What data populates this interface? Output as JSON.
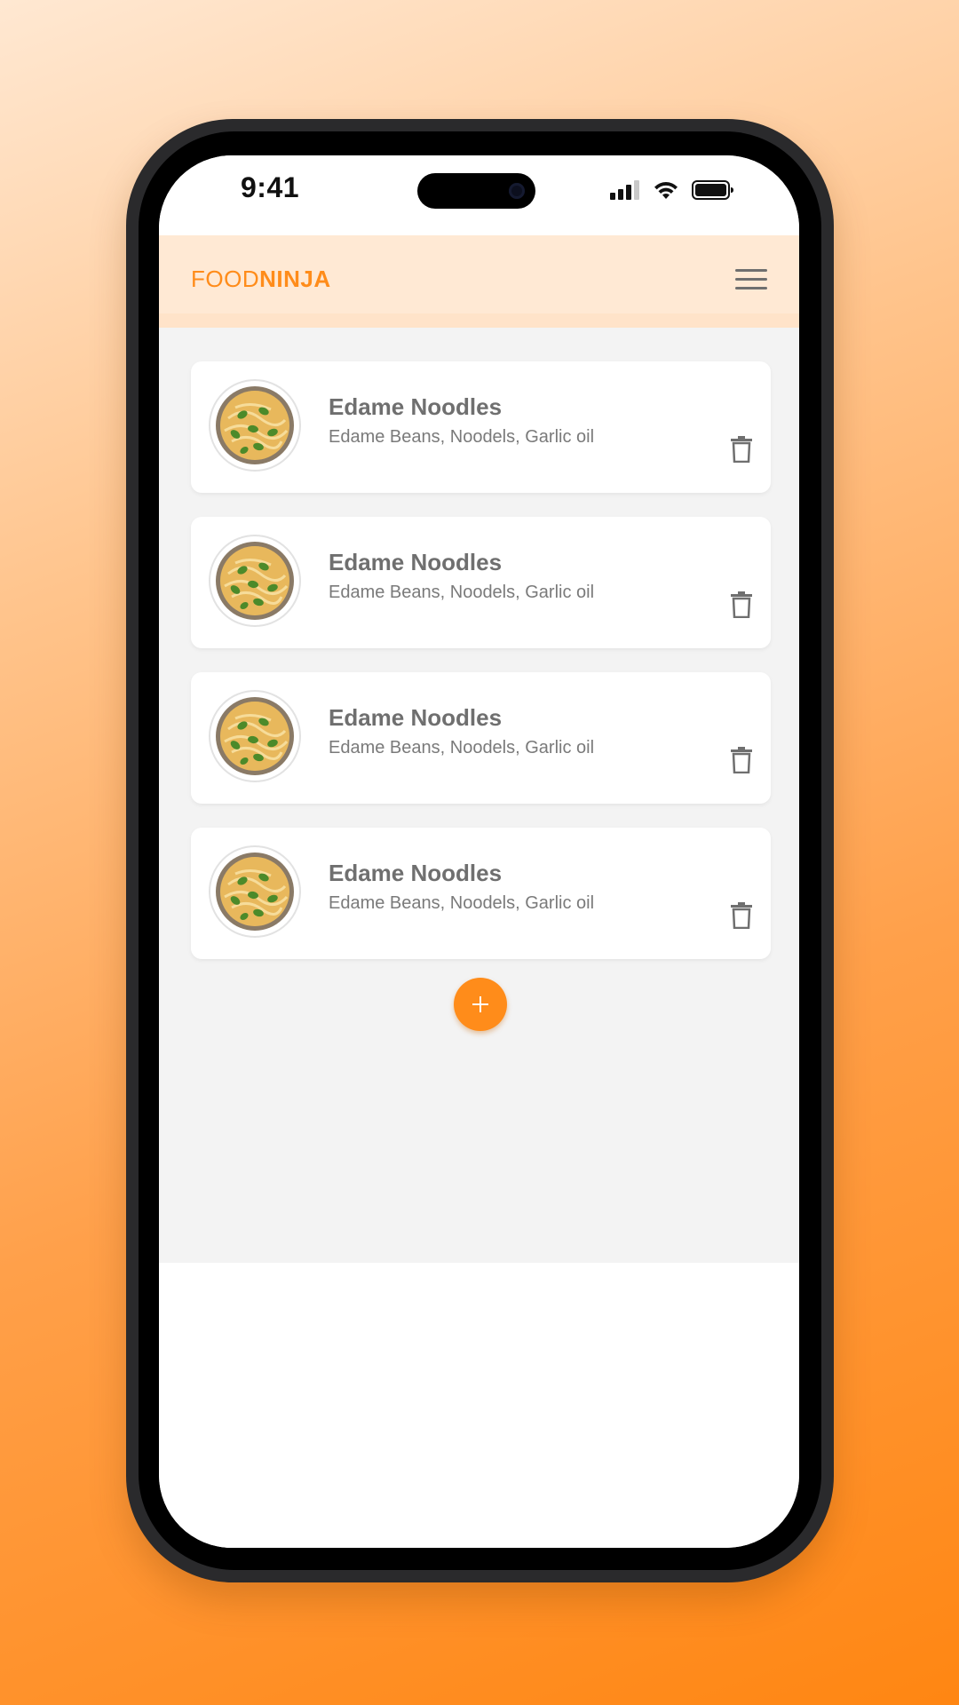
{
  "status_bar": {
    "time": "9:41"
  },
  "app_bar": {
    "brand_light": "FOOD",
    "brand_bold": "NINJA",
    "menu_icon": "hamburger-menu-icon"
  },
  "dishes": [
    {
      "title": "Edame Noodles",
      "description": "Edame Beans, Noodels, Garlic oil",
      "image_icon": "noodle-bowl-icon",
      "action_icon": "trash-icon"
    },
    {
      "title": "Edame Noodles",
      "description": "Edame Beans, Noodels, Garlic oil",
      "image_icon": "noodle-bowl-icon",
      "action_icon": "trash-icon"
    },
    {
      "title": "Edame Noodles",
      "description": "Edame Beans, Noodels, Garlic oil",
      "image_icon": "noodle-bowl-icon",
      "action_icon": "trash-icon"
    },
    {
      "title": "Edame Noodles",
      "description": "Edame Beans, Noodels, Garlic oil",
      "image_icon": "noodle-bowl-icon",
      "action_icon": "trash-icon"
    }
  ],
  "add_button": {
    "icon": "plus-icon"
  },
  "colors": {
    "accent": "#ff8c1a",
    "app_bar_bg": "#ffe9d4",
    "content_bg": "#f3f3f3",
    "card_bg": "#ffffff",
    "title_text": "#6f6f6f",
    "desc_text": "#7a7a7a"
  }
}
